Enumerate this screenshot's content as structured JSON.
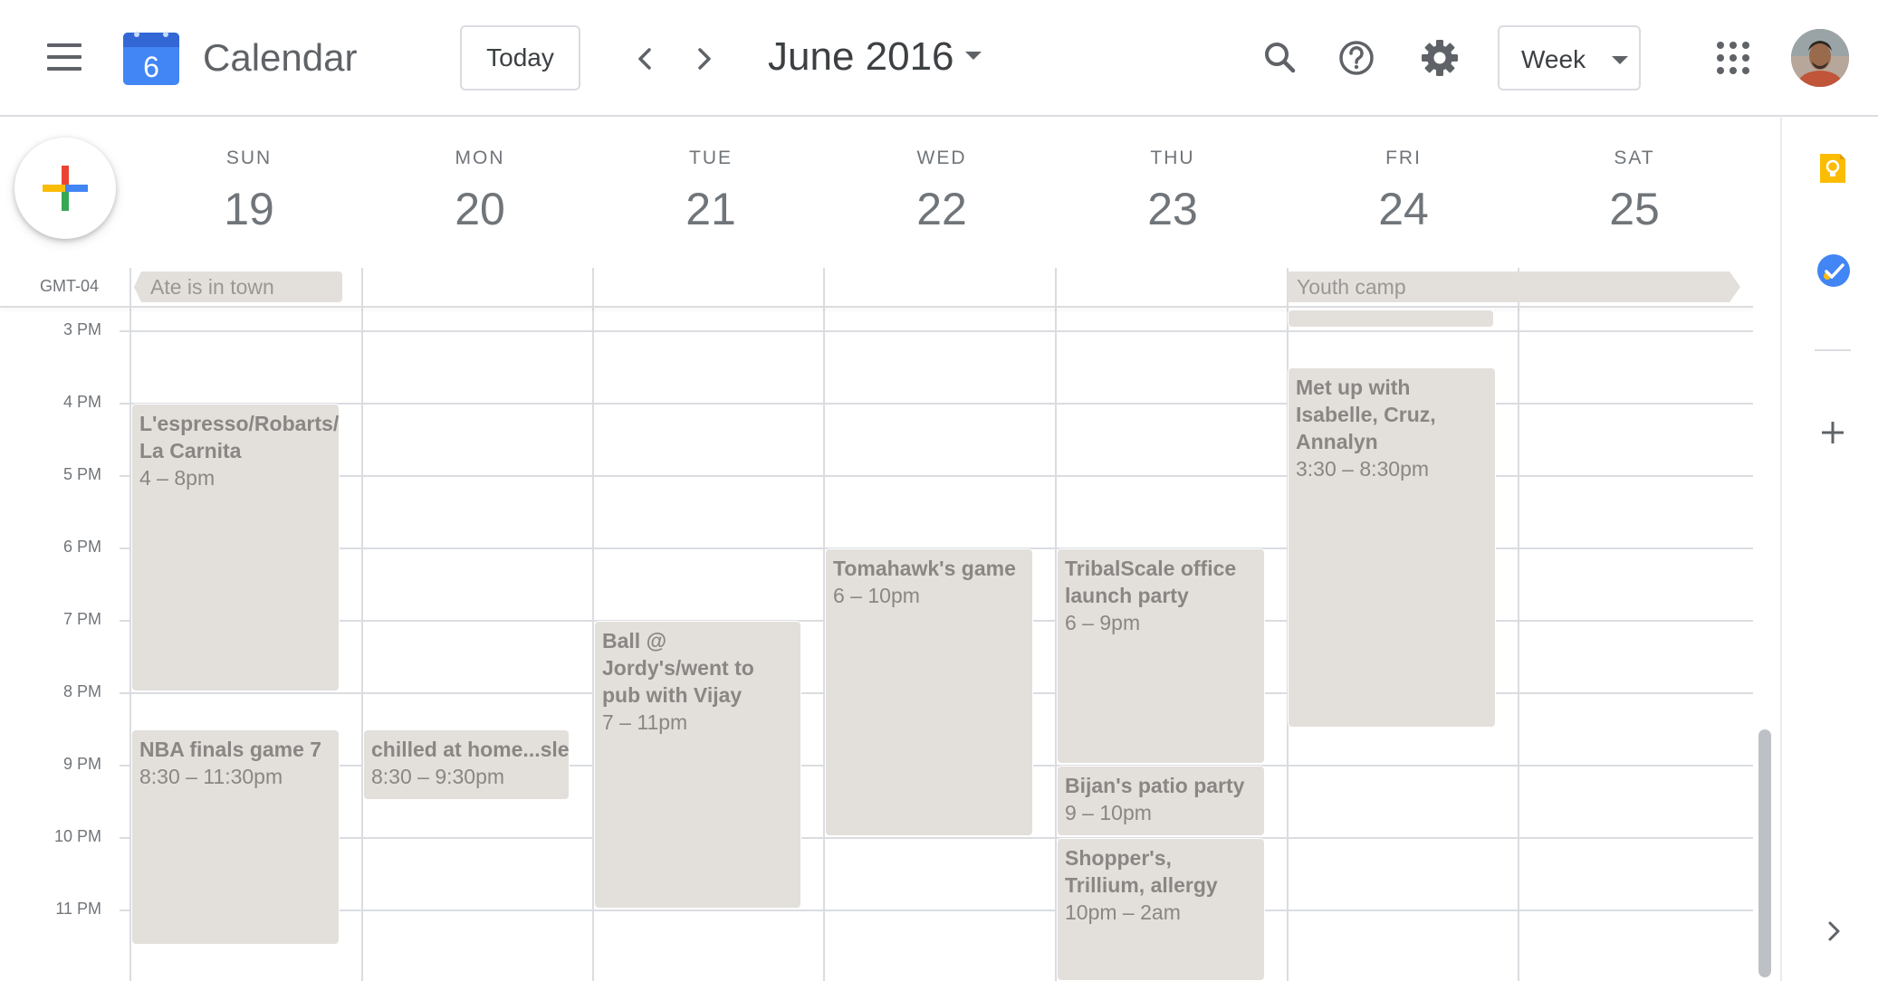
{
  "header": {
    "app_name": "Calendar",
    "logo_day": "6",
    "today_label": "Today",
    "month_title": "June 2016",
    "view_label": "Week",
    "icons": [
      "menu-icon",
      "previous-icon",
      "next-icon",
      "search-icon",
      "help-icon",
      "settings-icon",
      "apps-grid-icon"
    ]
  },
  "days": [
    {
      "name": "SUN",
      "num": "19"
    },
    {
      "name": "MON",
      "num": "20"
    },
    {
      "name": "TUE",
      "num": "21"
    },
    {
      "name": "WED",
      "num": "22"
    },
    {
      "name": "THU",
      "num": "23"
    },
    {
      "name": "FRI",
      "num": "24"
    },
    {
      "name": "SAT",
      "num": "25"
    }
  ],
  "timezone": "GMT-04",
  "hours": [
    "3 PM",
    "4 PM",
    "5 PM",
    "6 PM",
    "7 PM",
    "8 PM",
    "9 PM",
    "10 PM",
    "11 PM"
  ],
  "all_day_events": [
    {
      "title": "Ate is in town"
    },
    {
      "title": "Youth camp"
    }
  ],
  "events": [
    {
      "title": "L'espresso/Robarts/ La Carnita",
      "time": "4 – 8pm"
    },
    {
      "title": "NBA finals game 7",
      "time": "8:30 – 11:30pm"
    },
    {
      "title": "chilled at home...sle",
      "time": "8:30 – 9:30pm"
    },
    {
      "title": "Ball @ Jordy's/went to pub with Vijay",
      "time": "7 – 11pm"
    },
    {
      "title": "Tomahawk's game",
      "time": "6 – 10pm"
    },
    {
      "title": "TribalScale office launch party",
      "time": "6 – 9pm"
    },
    {
      "title": "Bijan's patio party",
      "time": "9 – 10pm"
    },
    {
      "title": "Shopper's, Trillium, allergy",
      "time": "10pm – 2am"
    },
    {
      "title": "Met up with Isabelle, Cruz, Annalyn",
      "time": "3:30 – 8:30pm"
    }
  ],
  "side_panel": {
    "icons": [
      "keep-icon",
      "tasks-icon",
      "add-icon",
      "expand-icon"
    ]
  },
  "colors": {
    "event_bg": "#e3e0dc",
    "event_text": "#8a8683",
    "grid_line": "#dadce0",
    "logo_blue": "#4285f4"
  }
}
